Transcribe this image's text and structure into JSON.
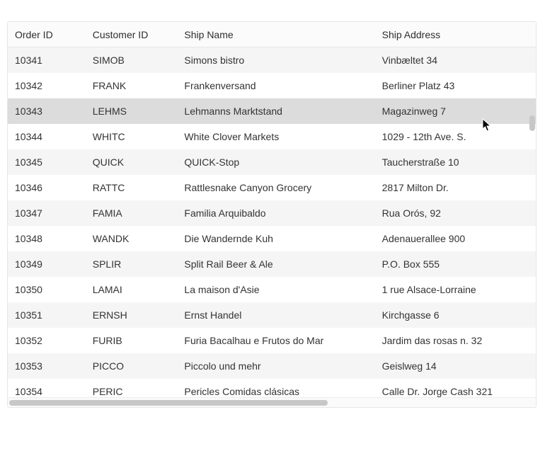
{
  "columns": [
    {
      "key": "order_id",
      "label": "Order ID"
    },
    {
      "key": "customer_id",
      "label": "Customer ID"
    },
    {
      "key": "ship_name",
      "label": "Ship Name"
    },
    {
      "key": "ship_address",
      "label": "Ship Address"
    }
  ],
  "hovered_index": 2,
  "rows": [
    {
      "order_id": "10341",
      "customer_id": "SIMOB",
      "ship_name": "Simons bistro",
      "ship_address": "Vinbæltet 34"
    },
    {
      "order_id": "10342",
      "customer_id": "FRANK",
      "ship_name": "Frankenversand",
      "ship_address": "Berliner Platz 43"
    },
    {
      "order_id": "10343",
      "customer_id": "LEHMS",
      "ship_name": "Lehmanns Marktstand",
      "ship_address": "Magazinweg 7"
    },
    {
      "order_id": "10344",
      "customer_id": "WHITC",
      "ship_name": "White Clover Markets",
      "ship_address": "1029 - 12th Ave. S."
    },
    {
      "order_id": "10345",
      "customer_id": "QUICK",
      "ship_name": "QUICK-Stop",
      "ship_address": "Taucherstraße 10"
    },
    {
      "order_id": "10346",
      "customer_id": "RATTC",
      "ship_name": "Rattlesnake Canyon Grocery",
      "ship_address": "2817 Milton Dr."
    },
    {
      "order_id": "10347",
      "customer_id": "FAMIA",
      "ship_name": "Familia Arquibaldo",
      "ship_address": "Rua Orós, 92"
    },
    {
      "order_id": "10348",
      "customer_id": "WANDK",
      "ship_name": "Die Wandernde Kuh",
      "ship_address": "Adenauerallee 900"
    },
    {
      "order_id": "10349",
      "customer_id": "SPLIR",
      "ship_name": "Split Rail Beer & Ale",
      "ship_address": "P.O. Box 555"
    },
    {
      "order_id": "10350",
      "customer_id": "LAMAI",
      "ship_name": "La maison d'Asie",
      "ship_address": "1 rue Alsace-Lorraine"
    },
    {
      "order_id": "10351",
      "customer_id": "ERNSH",
      "ship_name": "Ernst Handel",
      "ship_address": "Kirchgasse 6"
    },
    {
      "order_id": "10352",
      "customer_id": "FURIB",
      "ship_name": "Furia Bacalhau e Frutos do Mar",
      "ship_address": "Jardim das rosas n. 32"
    },
    {
      "order_id": "10353",
      "customer_id": "PICCO",
      "ship_name": "Piccolo und mehr",
      "ship_address": "Geislweg 14"
    },
    {
      "order_id": "10354",
      "customer_id": "PERIC",
      "ship_name": "Pericles Comidas clásicas",
      "ship_address": "Calle Dr. Jorge Cash 321"
    }
  ]
}
